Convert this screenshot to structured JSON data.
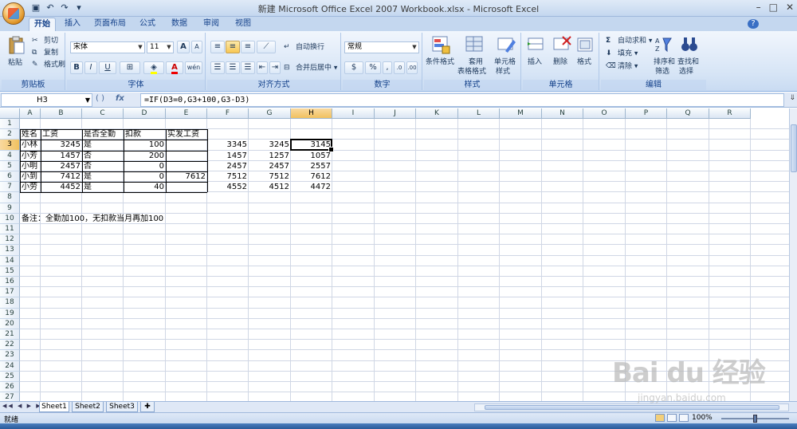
{
  "window": {
    "title": "新建 Microsoft Office Excel 2007 Workbook.xlsx - Microsoft Excel",
    "controls": [
      "–",
      "□",
      "✕"
    ]
  },
  "qat": {
    "save_icon": "save-icon",
    "undo_icon": "undo-icon",
    "redo_icon": "redo-icon",
    "customize": "▾"
  },
  "tabs": [
    {
      "label": "开始",
      "active": true
    },
    {
      "label": "插入"
    },
    {
      "label": "页面布局"
    },
    {
      "label": "公式"
    },
    {
      "label": "数据"
    },
    {
      "label": "审阅"
    },
    {
      "label": "视图"
    }
  ],
  "tab_help": "?",
  "ribbon": {
    "clipboard": {
      "label": "剪贴板",
      "paste": "粘贴",
      "cut": "剪切",
      "copy": "复制",
      "format_painter": "格式刷"
    },
    "font": {
      "label": "字体",
      "name": "宋体",
      "size": "11",
      "bold": "B",
      "italic": "I",
      "underline": "U",
      "grow": "A",
      "shrink": "A",
      "wen": "wén"
    },
    "alignment": {
      "label": "对齐方式",
      "wrap": "自动换行",
      "merge": "合并后居中"
    },
    "number": {
      "label": "数字",
      "format": "常规",
      "percent": "%",
      "comma": ","
    },
    "styles": {
      "label": "样式",
      "conditional": "条件格式",
      "table1": "套用",
      "table2": "表格格式",
      "cell1": "单元格",
      "cell2": "样式"
    },
    "cells": {
      "label": "单元格",
      "insert": "插入",
      "delete": "删除",
      "format": "格式"
    },
    "editing": {
      "label": "编辑",
      "autosum": "自动求和",
      "fill": "填充",
      "clear": "清除",
      "sort1": "排序和",
      "sort2": "筛选",
      "find1": "查找和",
      "find2": "选择"
    }
  },
  "formula_bar": {
    "name_box": "H3",
    "fx": "fx",
    "formula": "=IF(D3=0,G3+100,G3-D3)"
  },
  "columns": [
    "A",
    "B",
    "C",
    "D",
    "E",
    "F",
    "G",
    "H",
    "I",
    "J",
    "K",
    "L",
    "M",
    "N",
    "O",
    "P",
    "Q",
    "R"
  ],
  "selected_column": "H",
  "selected_row": "3",
  "rows": [
    "1",
    "2",
    "3",
    "4",
    "5",
    "6",
    "7",
    "8",
    "9",
    "10",
    "11",
    "12",
    "13",
    "14",
    "15",
    "16",
    "17",
    "18",
    "19",
    "20",
    "21",
    "22",
    "23",
    "24",
    "25",
    "26",
    "27"
  ],
  "cells": {
    "A2": "姓名",
    "B2": "工资",
    "C2": "是否全勤",
    "D2": "扣款",
    "E2": "实发工资",
    "A3": "小林",
    "B3": "3245",
    "C3": "是",
    "D3": "100",
    "F3": "3345",
    "G3": "3245",
    "H3": "3145",
    "A4": "小芳",
    "B4": "1457",
    "C4": "否",
    "D4": "200",
    "F4": "1457",
    "G4": "1257",
    "H4": "1057",
    "A5": "小明",
    "B5": "2457",
    "C5": "否",
    "D5": "0",
    "F5": "2457",
    "G5": "2457",
    "H5": "2557",
    "A6": "小到",
    "B6": "7412",
    "C6": "是",
    "D6": "0",
    "E6": "7612",
    "F6": "7512",
    "G6": "7512",
    "H6": "7612",
    "A7": "小劳",
    "B7": "4452",
    "C7": "是",
    "D7": "40",
    "F7": "4552",
    "G7": "4512",
    "H7": "4472",
    "A10": "备注：全勤加100，无扣款当月再加100"
  },
  "sheets": [
    {
      "label": "Sheet1",
      "active": true
    },
    {
      "label": "Sheet2"
    },
    {
      "label": "Sheet3"
    }
  ],
  "status": {
    "ready": "就绪",
    "zoom": "100%",
    "zoom_minus": "−",
    "zoom_plus": "+"
  },
  "watermark": {
    "main": "Bai du 经验",
    "sub": "jingyan.baidu.com"
  },
  "colors": {
    "selection_header": "#f1c15f",
    "ribbon_bg": "#d7e5f6",
    "title_bg": "#c4d7ef"
  }
}
